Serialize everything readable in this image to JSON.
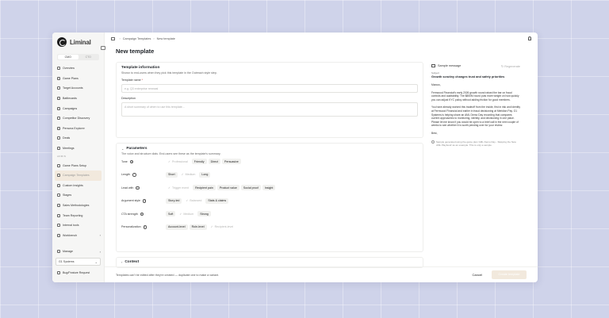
{
  "app": {
    "name": "Liminal"
  },
  "sidebar": {
    "role_tabs": [
      "CMO",
      "CTO"
    ],
    "items": [
      {
        "label": "Overview"
      },
      {
        "label": "Game Plans"
      },
      {
        "label": "Target Accounts"
      },
      {
        "label": "Battlecards"
      },
      {
        "label": "Campaigns"
      },
      {
        "label": "Competitor Discovery"
      },
      {
        "label": "Persona Explorer"
      },
      {
        "label": "Deals"
      },
      {
        "label": "Meetings"
      }
    ],
    "admin_section": "ADMIN",
    "admin_items": [
      {
        "label": "Game Plans Setup"
      },
      {
        "label": "Campaign Templates"
      },
      {
        "label": "Custom Insights"
      },
      {
        "label": "Stages"
      },
      {
        "label": "Sales Methodologies"
      },
      {
        "label": "Team Reporting"
      },
      {
        "label": "Internal tools"
      }
    ],
    "workbench": "Workbench",
    "manage": "Manage",
    "workspace": "G1 Systems",
    "bug_report": "Bug/Feature Request"
  },
  "breadcrumb": {
    "parent": "Campaign Templates",
    "current": "New template"
  },
  "page": {
    "title": "New template"
  },
  "template_info": {
    "title": "Template information",
    "subtitle": "Shown to end-users when they pick this template in the Outreach style step.",
    "name_label": "Template name",
    "name_required": "*",
    "name_placeholder": "e.g. Q3 enterprise renewal",
    "description_label": "Description",
    "description_placeholder": "A short summary of when to use this template..."
  },
  "parameters": {
    "title": "Parameters",
    "subtitle": "The voice and structure dials. End-users see these as the template's summary.",
    "rows": [
      {
        "label": "Tone",
        "options": [
          {
            "text": "Professional",
            "state": "muted"
          },
          {
            "text": "Friendly",
            "state": "selected"
          },
          {
            "text": "Direct",
            "state": "selected"
          },
          {
            "text": "Persuasive",
            "state": "selected"
          }
        ]
      },
      {
        "label": "Length",
        "options": [
          {
            "text": "Short",
            "state": "selected"
          },
          {
            "text": "Medium",
            "state": "muted"
          },
          {
            "text": "Long",
            "state": "selected"
          }
        ]
      },
      {
        "label": "Lead with",
        "options": [
          {
            "text": "Trigger event",
            "state": "muted"
          },
          {
            "text": "Recipient pain",
            "state": "selected"
          },
          {
            "text": "Product value",
            "state": "selected"
          },
          {
            "text": "Social proof",
            "state": "selected"
          },
          {
            "text": "Insight",
            "state": "selected"
          }
        ]
      },
      {
        "label": "Argument style",
        "options": [
          {
            "text": "Story-led",
            "state": "selected"
          },
          {
            "text": "Balanced",
            "state": "muted"
          },
          {
            "text": "Stats & claims",
            "state": "selected"
          }
        ]
      },
      {
        "label": "CTA strength",
        "options": [
          {
            "text": "Soft",
            "state": "selected"
          },
          {
            "text": "Medium",
            "state": "muted"
          },
          {
            "text": "Strong",
            "state": "selected"
          }
        ]
      },
      {
        "label": "Personalization",
        "options": [
          {
            "text": "Account-level",
            "state": "selected"
          },
          {
            "text": "Role-level",
            "state": "selected"
          },
          {
            "text": "Recipient-level",
            "state": "muted"
          }
        ]
      }
    ]
  },
  "context": {
    "title": "Context"
  },
  "preview": {
    "title": "Sample message",
    "regenerate": "Regenerate",
    "subject_label": "Subject",
    "subject": "Growth scrutiny changes trust and safety priorities",
    "greeting": "Marcus,",
    "paragraph1": "Fernwood Financial's early 2026 growth round raised the bar on fraud controls and auditability. The $850M round puts more weight on how quickly you can adjust KYC policy without adding friction for good members.",
    "paragraph2": "You have already worked this tradeoff from the inside, first in risk and identity at Fernwood Financial and earlier in fraud decisioning at Meridian Pay. G1 Systems is helping share an AML Demo Day recording that compares current approaches to monitoring, identity, and decisioning in one place. Please let me know if you would be open to a brief call in the next couple of weeks to see whether it is worth pending over for your review.",
    "signoff": "Best,",
    "note": "Sample generated using the game plan 'AML Demo Day - Skipping the New AML Playbook' as an example. This is only a sample."
  },
  "footer": {
    "note": "Templates can't be edited after they're created — duplicate one to make a variant.",
    "cancel": "Cancel",
    "create": "Create template"
  },
  "colors": {
    "accent_soft": "#f2e9dd",
    "background": "#cfd3ea"
  }
}
